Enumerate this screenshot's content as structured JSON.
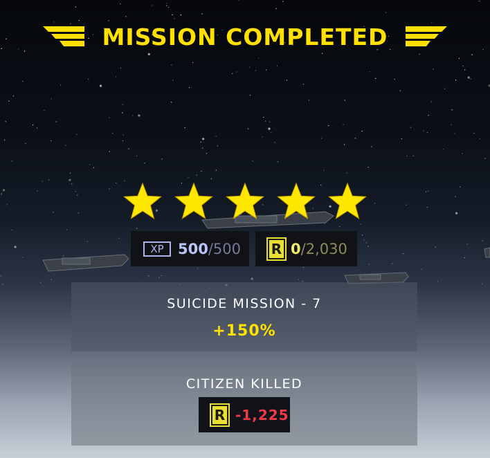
{
  "title": "MISSION COMPLETED",
  "colors": {
    "accent": "#ffe000",
    "xp": "#a9b6ee",
    "reputation": "#e8df30",
    "penalty": "#f03a48"
  },
  "rating": {
    "stars_filled": 5,
    "stars_total": 5,
    "icon": "star-icon"
  },
  "rewards": {
    "xp": {
      "badge": "XP",
      "current": "500",
      "separator": "/",
      "total": "500"
    },
    "reputation": {
      "badge": "R",
      "current": "0",
      "separator": "/",
      "total": "2,030"
    }
  },
  "bonuses": [
    {
      "name": "SUICIDE MISSION - 7",
      "value": "+150%"
    },
    {
      "name": "CITIZEN KILLED",
      "badge": "R",
      "value": "-1,225"
    }
  ]
}
